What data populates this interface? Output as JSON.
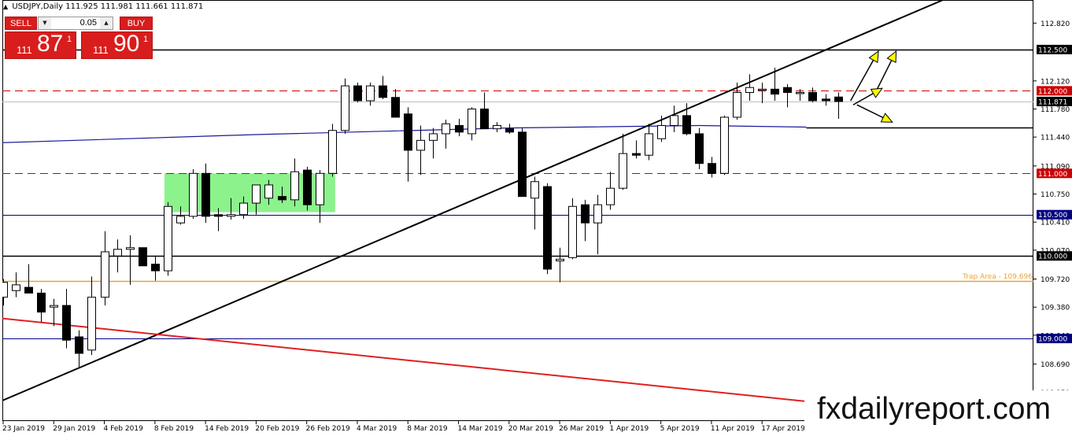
{
  "header": {
    "symbol_text": "USDJPY,Daily",
    "ohlc_text": "111.925 111.981 111.661 111.871"
  },
  "trade_panel": {
    "sell_label": "SELL",
    "buy_label": "BUY",
    "lot_value": "0.05",
    "sell_prefix": "111",
    "sell_big": "87",
    "sell_sup": "1",
    "buy_prefix": "111",
    "buy_big": "90",
    "buy_sup": "1"
  },
  "watermark": "fxdailyreport.com",
  "colors": {
    "bull_fill": "#ffffff",
    "bear_fill": "#000000",
    "red_level": "#cc0000",
    "blue_level": "#000080",
    "ma": "#1a1a9a",
    "orange": "#e8a33a",
    "zone": "#66ee66",
    "arrow": "#ffff00",
    "label_red": "#cc0000",
    "label_blue": "#000080",
    "label_black": "#000000"
  },
  "chart_data": {
    "type": "candlestick",
    "symbol": "USDJPY",
    "timeframe": "Daily",
    "ylim": [
      108.0,
      113.1
    ],
    "y_ticks": [
      "112.820",
      "112.120",
      "111.780",
      "111.440",
      "111.090",
      "110.750",
      "110.410",
      "110.070",
      "109.720",
      "109.380",
      "109.040",
      "108.690",
      "108.350"
    ],
    "x_labels": [
      "23 Jan 2019",
      "29 Jan 2019",
      "4 Feb 2019",
      "8 Feb 2019",
      "14 Feb 2019",
      "20 Feb 2019",
      "26 Feb 2019",
      "4 Mar 2019",
      "8 Mar 2019",
      "14 Mar 2019",
      "20 Mar 2019",
      "26 Mar 2019",
      "1 Apr 2019",
      "5 Apr 2019",
      "11 Apr 2019",
      "17 Apr 2019"
    ],
    "x_label_bars": [
      0,
      4,
      8,
      12,
      16,
      20,
      24,
      28,
      32,
      36,
      40,
      44,
      48,
      52,
      56,
      60
    ],
    "levels": [
      {
        "price": 112.5,
        "label": "112.500",
        "style": "black-solid"
      },
      {
        "price": 112.0,
        "label": "112.000",
        "style": "red-dashed"
      },
      {
        "price": 111.0,
        "label": "111.000",
        "style": "red-dashed"
      },
      {
        "price": 110.5,
        "label": "110.500",
        "style": "blue-solid"
      },
      {
        "price": 110.0,
        "label": "110.000",
        "style": "black-solid"
      },
      {
        "price": 109.0,
        "label": "109.000",
        "style": "blue-solid"
      }
    ],
    "current_price": {
      "price": 111.871,
      "label": "111.871"
    },
    "annotations": [
      {
        "text": "Trap Area - 109.696",
        "price": 109.696
      }
    ],
    "support_line_price": 111.56,
    "zone": {
      "from_bar": 13,
      "to_bar": 26,
      "price_low": 110.53,
      "price_high": 111.0
    },
    "trendlines": [
      {
        "name": "ascending",
        "points": [
          {
            "bar": -0.5,
            "price": 108.22
          },
          {
            "bar": 74.3,
            "price": 113.1
          }
        ]
      },
      {
        "name": "descending",
        "points": [
          {
            "bar": -0.5,
            "price": 109.25
          },
          {
            "bar": 77.3,
            "price": 108.02
          }
        ]
      }
    ],
    "moving_average": [
      {
        "bar": -0.5,
        "price": 111.37
      },
      {
        "bar": 20,
        "price": 111.47
      },
      {
        "bar": 40,
        "price": 111.55
      },
      {
        "bar": 55,
        "price": 111.58
      },
      {
        "bar": 63.5,
        "price": 111.56
      }
    ],
    "candles": [
      {
        "o": 109.5,
        "h": 109.72,
        "l": 109.4,
        "c": 109.68
      },
      {
        "o": 109.58,
        "h": 109.8,
        "l": 109.5,
        "c": 109.65
      },
      {
        "o": 109.62,
        "h": 109.9,
        "l": 109.55,
        "c": 109.55
      },
      {
        "o": 109.55,
        "h": 109.6,
        "l": 109.2,
        "c": 109.32
      },
      {
        "o": 109.38,
        "h": 109.48,
        "l": 109.15,
        "c": 109.4
      },
      {
        "o": 109.4,
        "h": 109.6,
        "l": 108.88,
        "c": 108.98
      },
      {
        "o": 109.02,
        "h": 109.1,
        "l": 108.64,
        "c": 108.82
      },
      {
        "o": 108.86,
        "h": 109.75,
        "l": 108.8,
        "c": 109.5
      },
      {
        "o": 109.5,
        "h": 110.3,
        "l": 109.4,
        "c": 110.05
      },
      {
        "o": 110.0,
        "h": 110.2,
        "l": 109.8,
        "c": 110.08
      },
      {
        "o": 110.08,
        "h": 110.25,
        "l": 109.65,
        "c": 110.1
      },
      {
        "o": 110.1,
        "h": 110.1,
        "l": 109.9,
        "c": 109.88
      },
      {
        "o": 109.9,
        "h": 110.0,
        "l": 109.7,
        "c": 109.82
      },
      {
        "o": 109.82,
        "h": 110.65,
        "l": 109.76,
        "c": 110.6
      },
      {
        "o": 110.4,
        "h": 110.6,
        "l": 110.38,
        "c": 110.48
      },
      {
        "o": 110.48,
        "h": 111.05,
        "l": 110.45,
        "c": 111.0
      },
      {
        "o": 111.0,
        "h": 111.12,
        "l": 110.4,
        "c": 110.48
      },
      {
        "o": 110.5,
        "h": 110.58,
        "l": 110.3,
        "c": 110.48
      },
      {
        "o": 110.48,
        "h": 110.7,
        "l": 110.44,
        "c": 110.5
      },
      {
        "o": 110.5,
        "h": 110.72,
        "l": 110.45,
        "c": 110.64
      },
      {
        "o": 110.64,
        "h": 110.86,
        "l": 110.5,
        "c": 110.86
      },
      {
        "o": 110.7,
        "h": 110.92,
        "l": 110.62,
        "c": 110.86
      },
      {
        "o": 110.72,
        "h": 110.84,
        "l": 110.64,
        "c": 110.68
      },
      {
        "o": 110.68,
        "h": 111.18,
        "l": 110.6,
        "c": 111.02
      },
      {
        "o": 111.04,
        "h": 111.08,
        "l": 110.55,
        "c": 110.62
      },
      {
        "o": 110.62,
        "h": 111.04,
        "l": 110.4,
        "c": 111.0
      },
      {
        "o": 111.0,
        "h": 111.6,
        "l": 110.96,
        "c": 111.52
      },
      {
        "o": 111.52,
        "h": 112.15,
        "l": 111.48,
        "c": 112.06
      },
      {
        "o": 112.06,
        "h": 112.1,
        "l": 111.86,
        "c": 111.88
      },
      {
        "o": 111.88,
        "h": 112.1,
        "l": 111.82,
        "c": 112.06
      },
      {
        "o": 112.06,
        "h": 112.18,
        "l": 111.9,
        "c": 111.92
      },
      {
        "o": 111.92,
        "h": 112.02,
        "l": 111.7,
        "c": 111.68
      },
      {
        "o": 111.72,
        "h": 111.8,
        "l": 110.9,
        "c": 111.28
      },
      {
        "o": 111.28,
        "h": 111.58,
        "l": 110.98,
        "c": 111.4
      },
      {
        "o": 111.4,
        "h": 111.55,
        "l": 111.18,
        "c": 111.48
      },
      {
        "o": 111.48,
        "h": 111.65,
        "l": 111.3,
        "c": 111.6
      },
      {
        "o": 111.58,
        "h": 111.66,
        "l": 111.45,
        "c": 111.5
      },
      {
        "o": 111.48,
        "h": 111.8,
        "l": 111.4,
        "c": 111.78
      },
      {
        "o": 111.78,
        "h": 111.98,
        "l": 111.56,
        "c": 111.54
      },
      {
        "o": 111.54,
        "h": 111.62,
        "l": 111.5,
        "c": 111.58
      },
      {
        "o": 111.54,
        "h": 111.6,
        "l": 111.48,
        "c": 111.5
      },
      {
        "o": 111.5,
        "h": 111.55,
        "l": 110.72,
        "c": 110.72
      },
      {
        "o": 110.7,
        "h": 110.96,
        "l": 110.32,
        "c": 110.9
      },
      {
        "o": 110.84,
        "h": 110.88,
        "l": 109.78,
        "c": 109.84
      },
      {
        "o": 109.94,
        "h": 110.1,
        "l": 109.68,
        "c": 109.96
      },
      {
        "o": 109.98,
        "h": 110.7,
        "l": 109.96,
        "c": 110.6
      },
      {
        "o": 110.62,
        "h": 110.68,
        "l": 110.18,
        "c": 110.4
      },
      {
        "o": 110.4,
        "h": 110.74,
        "l": 110.02,
        "c": 110.62
      },
      {
        "o": 110.62,
        "h": 111.02,
        "l": 110.56,
        "c": 110.82
      },
      {
        "o": 110.82,
        "h": 111.48,
        "l": 110.8,
        "c": 111.24
      },
      {
        "o": 111.24,
        "h": 111.4,
        "l": 111.18,
        "c": 111.22
      },
      {
        "o": 111.22,
        "h": 111.6,
        "l": 111.16,
        "c": 111.48
      },
      {
        "o": 111.42,
        "h": 111.7,
        "l": 111.38,
        "c": 111.58
      },
      {
        "o": 111.58,
        "h": 111.82,
        "l": 111.5,
        "c": 111.7
      },
      {
        "o": 111.7,
        "h": 111.85,
        "l": 111.46,
        "c": 111.48
      },
      {
        "o": 111.48,
        "h": 111.55,
        "l": 111.05,
        "c": 111.12
      },
      {
        "o": 111.12,
        "h": 111.2,
        "l": 110.95,
        "c": 111.0
      },
      {
        "o": 111.0,
        "h": 111.7,
        "l": 110.98,
        "c": 111.68
      },
      {
        "o": 111.68,
        "h": 112.1,
        "l": 111.65,
        "c": 111.98
      },
      {
        "o": 111.98,
        "h": 112.2,
        "l": 111.88,
        "c": 112.04
      },
      {
        "o": 112.02,
        "h": 112.1,
        "l": 111.85,
        "c": 112.02
      },
      {
        "o": 112.02,
        "h": 112.28,
        "l": 111.88,
        "c": 111.96
      },
      {
        "o": 112.04,
        "h": 112.08,
        "l": 111.8,
        "c": 111.98
      },
      {
        "o": 111.98,
        "h": 112.02,
        "l": 111.88,
        "c": 111.98
      },
      {
        "o": 111.98,
        "h": 112.04,
        "l": 111.86,
        "c": 111.88
      },
      {
        "o": 111.9,
        "h": 111.96,
        "l": 111.82,
        "c": 111.88
      },
      {
        "o": 111.925,
        "h": 111.981,
        "l": 111.661,
        "c": 111.871
      }
    ],
    "projection_arrows": [
      {
        "from": {
          "bar": 67.0,
          "price": 111.88
        },
        "to": {
          "bar": 69.2,
          "price": 112.48
        }
      },
      {
        "from": {
          "bar": 69.0,
          "price": 111.99
        },
        "to": {
          "bar": 70.6,
          "price": 112.48
        }
      },
      {
        "from": {
          "bar": 67.2,
          "price": 111.83
        },
        "to": {
          "bar": 69.5,
          "price": 112.03
        }
      },
      {
        "from": {
          "bar": 67.5,
          "price": 111.83
        },
        "to": {
          "bar": 70.3,
          "price": 111.62
        }
      }
    ]
  }
}
